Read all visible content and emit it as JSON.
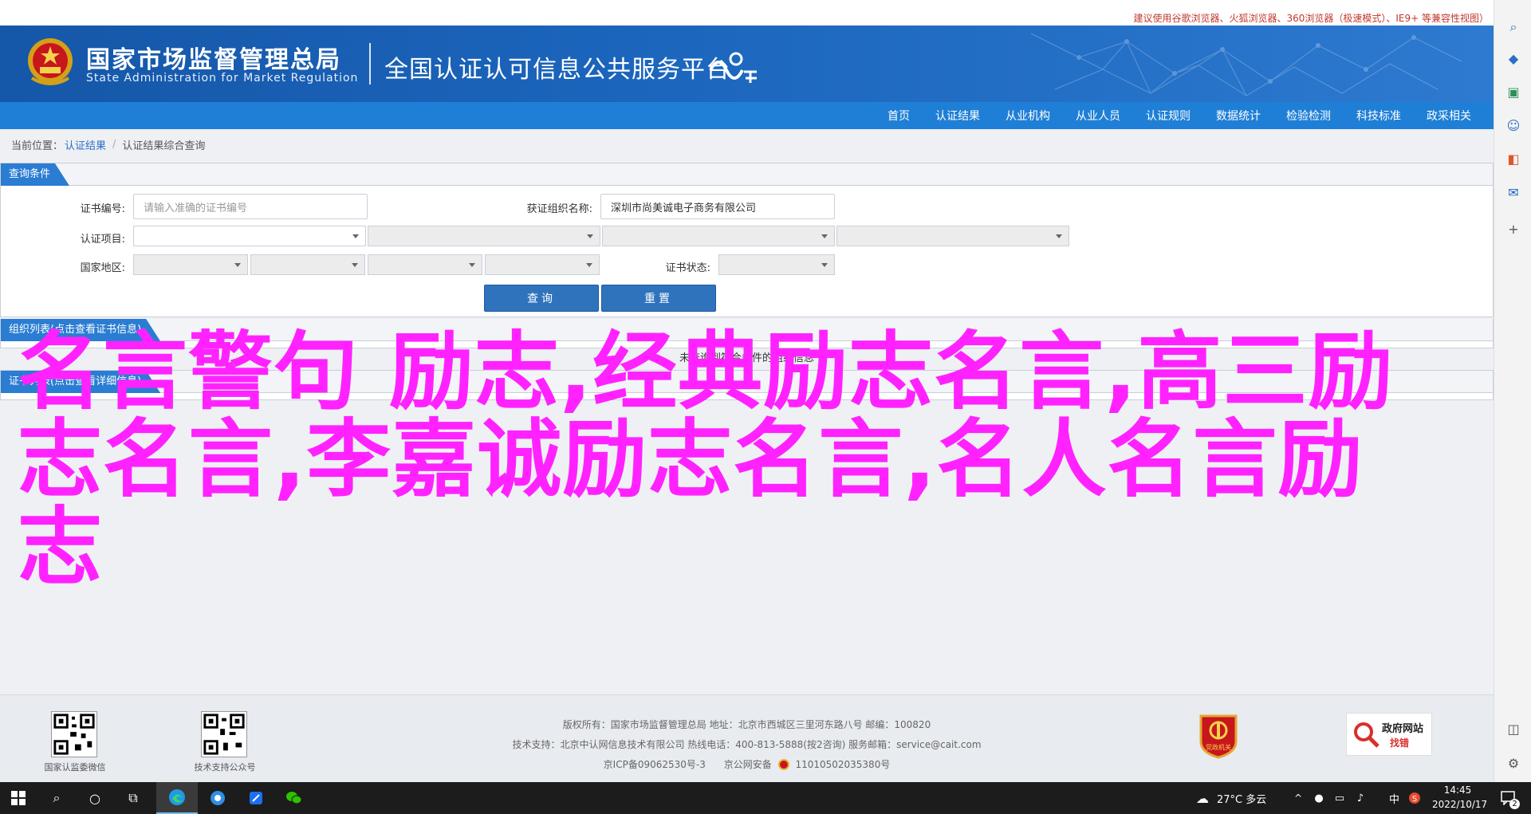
{
  "compat_notice": "建议使用谷歌浏览器、火狐浏览器、360浏览器（极速模式）、IE9+ 等兼容性视图）",
  "header": {
    "org_cn": "国家市场监督管理总局",
    "org_en": "State Administration  for  Market Regulation",
    "platform": "全国认证认可信息公共服务平台"
  },
  "nav": [
    "首页",
    "认证结果",
    "从业机构",
    "从业人员",
    "认证规则",
    "数据统计",
    "检验检测",
    "科技标准",
    "政采相关"
  ],
  "breadcrumb": {
    "prefix": "当前位置：",
    "level1": "认证结果",
    "sep": "/",
    "level2": "认证结果综合查询"
  },
  "query_panel": {
    "title": "查询条件",
    "cert_no_label": "证书编号:",
    "cert_no_placeholder": "请输入准确的证书编号",
    "org_label": "获证组织名称:",
    "org_value": "深圳市尚美诚电子商务有限公司",
    "project_label": "认证项目:",
    "region_label": "国家地区:",
    "status_label": "证书状态:",
    "search_btn": "查询",
    "reset_btn": "重置"
  },
  "list_panel": {
    "title": "组织列表(点击查看证书信息)",
    "message": "未查询到符合条件的组织信息"
  },
  "cert_panel": {
    "title": "证书列表(点击查看详细信息)"
  },
  "overlay_text": "名言警句 励志,经典励志名言,高三励志名言,李嘉诚励志名言,名人名言励志",
  "footer": {
    "qr1_caption": "国家认监委微信",
    "qr2_caption": "技术支持公众号",
    "line1": "版权所有：国家市场监督管理总局    地址：北京市西城区三里河东路八号    邮编：100820",
    "line2": "技术支持：北京中认网信息技术有限公司    热线电话：400-813-5888(按2咨询)    服务邮箱：service@cait.com",
    "line3_icp": "京ICP备09062530号-3",
    "line3_police": "京公网安备",
    "line3_no": "11010502035380号",
    "badge_caption": "党政机关",
    "gov_badge_top": "政府网站",
    "gov_badge_bottom": "找错"
  },
  "taskbar": {
    "weather": "27°C  多云",
    "ime": "中",
    "time": "14:45",
    "date": "2022/10/17",
    "notif_count": "2"
  },
  "colors": {
    "header_blue": "#1c66be",
    "nav_blue": "#1f7fd6",
    "overlay_magenta": "#ff22ff"
  }
}
